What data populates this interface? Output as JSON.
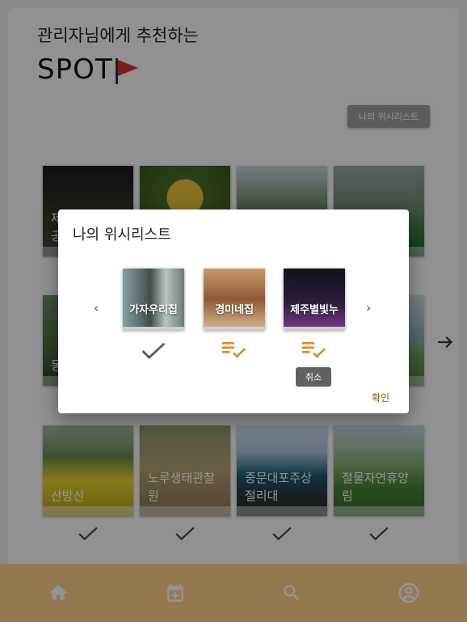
{
  "header": {
    "line1": "관리자님에게 추천하는",
    "line2": "SPOT"
  },
  "wishlist_button": "나의 위시리스트",
  "grid": {
    "row1": [
      {
        "label": "제\n공"
      },
      {
        "label": ""
      },
      {
        "label": ""
      },
      {
        "label": ""
      }
    ],
    "row2": [
      {
        "label": "동"
      },
      {
        "label": ""
      },
      {
        "label": ""
      },
      {
        "label": ""
      }
    ],
    "row3": [
      {
        "label": "산방산"
      },
      {
        "label": "노루생태관찰원"
      },
      {
        "label": "중문대포주상절리대"
      },
      {
        "label": "절물자연휴양림"
      }
    ]
  },
  "dialog": {
    "title": "나의 위시리스트",
    "items": [
      {
        "label": "가자우리집",
        "icon": "check-icon",
        "color": "#555555"
      },
      {
        "label": "경미네집",
        "icon": "playlist-check-icon",
        "color": "#e08a1e"
      },
      {
        "label": "제주별빛누",
        "icon": "playlist-check-icon",
        "color": "#e08a1e"
      }
    ],
    "tooltip": "취소",
    "confirm": "확인"
  },
  "bottom_nav": {
    "items": [
      "home-icon",
      "calendar-add-icon",
      "search-icon",
      "account-icon"
    ]
  },
  "colors": {
    "accent": "#e08a1e",
    "bottom_nav_bg": "#ffd08a"
  }
}
